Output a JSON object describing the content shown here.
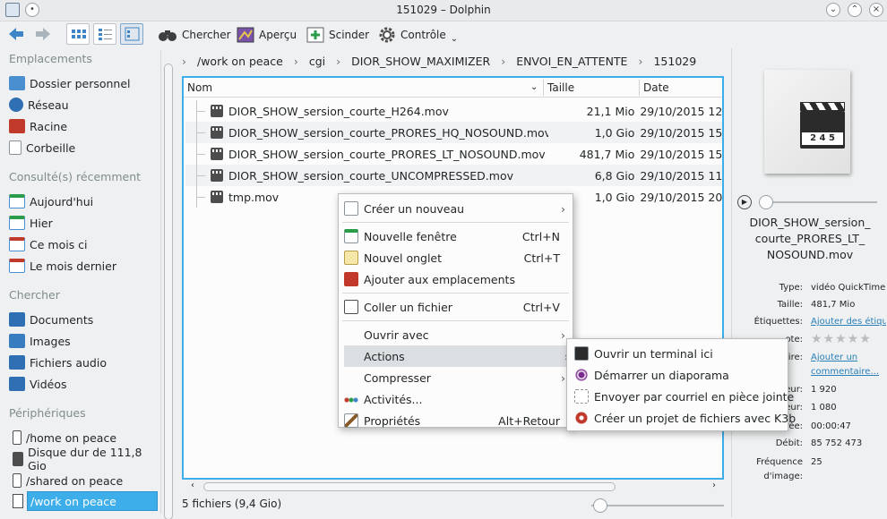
{
  "window": {
    "title": "151029 – Dolphin"
  },
  "toolbar": {
    "search_label": "Chercher",
    "preview_label": "Aperçu",
    "split_label": "Scinder",
    "control_label": "Contrôle"
  },
  "sidebar": {
    "sections": [
      {
        "title": "Emplacements",
        "items": [
          "Dossier personnel",
          "Réseau",
          "Racine",
          "Corbeille"
        ]
      },
      {
        "title": "Consulté(s) récemment",
        "items": [
          "Aujourd'hui",
          "Hier",
          "Ce mois ci",
          "Le mois dernier"
        ]
      },
      {
        "title": "Chercher",
        "items": [
          "Documents",
          "Images",
          "Fichiers audio",
          "Vidéos"
        ]
      },
      {
        "title": "Périphériques",
        "items": [
          "/home on peace",
          "Disque dur de 111,8 Gio",
          "/shared on peace",
          "/work on peace"
        ]
      }
    ]
  },
  "breadcrumb": [
    "/work on peace",
    "cgi",
    "DIOR_SHOW_MAXIMIZER",
    "ENVOI_EN_ATTENTE",
    "151029"
  ],
  "columns": {
    "name": "Nom",
    "size": "Taille",
    "date": "Date"
  },
  "files": [
    {
      "name": "DIOR_SHOW_sersion_courte_H264.mov",
      "size": "21,1 Mio",
      "date": "29/10/2015 12:"
    },
    {
      "name": "DIOR_SHOW_sersion_courte_PRORES_HQ_NOSOUND.mov",
      "size": "1,0 Gio",
      "date": "29/10/2015 15:"
    },
    {
      "name": "DIOR_SHOW_sersion_courte_PRORES_LT_NOSOUND.mov",
      "size": "481,7 Mio",
      "date": "29/10/2015 15:"
    },
    {
      "name": "DIOR_SHOW_sersion_courte_UNCOMPRESSED.mov",
      "size": "6,8 Gio",
      "date": "29/10/2015 11:"
    },
    {
      "name": "tmp.mov",
      "size": "1,0 Gio",
      "date": "29/10/2015 20:"
    }
  ],
  "status": {
    "text": "5 fichiers (9,4 Gio)"
  },
  "context_menu": {
    "items": [
      {
        "label": "Créer un nouveau",
        "shortcut": "",
        "submenu": true
      },
      {
        "label": "Nouvelle fenêtre",
        "shortcut": "Ctrl+N",
        "submenu": false
      },
      {
        "label": "Nouvel onglet",
        "shortcut": "Ctrl+T",
        "submenu": false
      },
      {
        "label": "Ajouter aux emplacements",
        "shortcut": "",
        "submenu": false
      },
      {
        "label": "Coller un fichier",
        "shortcut": "Ctrl+V",
        "submenu": false
      },
      {
        "label": "Ouvrir avec",
        "shortcut": "",
        "submenu": true
      },
      {
        "label": "Actions",
        "shortcut": "",
        "submenu": true
      },
      {
        "label": "Compresser",
        "shortcut": "",
        "submenu": true
      },
      {
        "label": "Activités...",
        "shortcut": "",
        "submenu": false
      },
      {
        "label": "Propriétés",
        "shortcut": "Alt+Retour",
        "submenu": false
      }
    ],
    "submenu_arrow": "›"
  },
  "actions_submenu": [
    "Ouvrir un terminal ici",
    "Démarrer un diaporama",
    "Envoyer par courriel en pièce jointe",
    "Créer un projet de fichiers avec K3b"
  ],
  "info_panel": {
    "preview_badge": "2 4 5",
    "file_name_lines": [
      "DIOR_SHOW_sersion_",
      "courte_PRORES_LT_",
      "NOSOUND.mov"
    ],
    "fields": [
      {
        "key": "Type:",
        "value": "vidéo QuickTime",
        "link": false
      },
      {
        "key": "Taille:",
        "value": "481,7 Mio",
        "link": false
      },
      {
        "key": "Étiquettes:",
        "value": "Ajouter des étiqu",
        "link": true
      },
      {
        "key": "ote:",
        "value": "",
        "link": false
      },
      {
        "key": "ire:",
        "value": "Ajouter un",
        "link": true
      },
      {
        "key": "",
        "value": "commentaire...",
        "link": true
      },
      {
        "key": "eur:",
        "value": "1 920",
        "link": false
      },
      {
        "key": "eur:",
        "value": "1 080",
        "link": false
      },
      {
        "key": "Durée:",
        "value": "00:00:47",
        "link": false
      },
      {
        "key": "Débit:",
        "value": "85 752 473",
        "link": false
      },
      {
        "key": "Fréquence",
        "value": "25",
        "link": false
      },
      {
        "key": "d'image:",
        "value": "",
        "link": false
      }
    ],
    "rating_stars": "★★★★★"
  },
  "colors": {
    "accent": "#3daee9",
    "menu_highlight": "#dcdfe2",
    "link": "#2980b9"
  }
}
